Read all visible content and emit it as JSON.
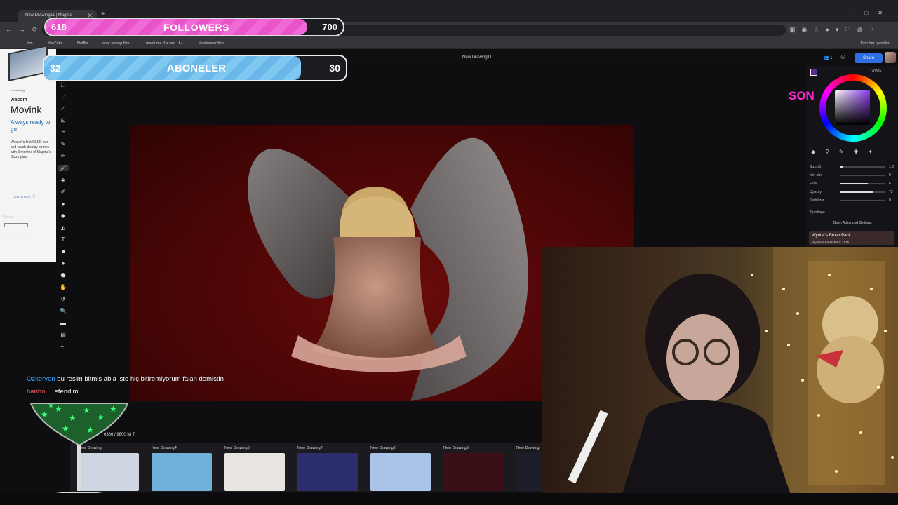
{
  "browser": {
    "tab_title": "New Drawing11 | Magma",
    "bookmarks": [
      "film",
      "YouTube",
      "Netflix",
      "onur savaşı film",
      "mach me if u can - f...",
      "Zoolander film",
      "Tüm Yer İşaretleri"
    ]
  },
  "app": {
    "doc_title": "New Drawing11",
    "user_count": "1",
    "share_label": "Share"
  },
  "overlay": {
    "followers": {
      "current": "618",
      "label": "FOLLOWERS",
      "goal": "700",
      "progress": 0.88
    },
    "subs": {
      "current": "32",
      "label": "ABONELER",
      "goal": "30",
      "progress": 0.85
    },
    "side_text": "SON"
  },
  "ad": {
    "intro": "Introducing",
    "brand": "wacom",
    "product": "Movink",
    "tagline": "Always ready to go",
    "desc": "Wacom's first OLED pen and touch display comes with 3 months of Magma's Blaze plan.",
    "learn_more": "Learn more",
    "privacy": "Privacy",
    "remove_ads": "Remove ads"
  },
  "color_panel": {
    "hex": "1c082e",
    "size_label": "Size x1",
    "size_val": "1.0",
    "sliders": [
      {
        "label": "Min size",
        "value": "0",
        "fill": 0.0
      },
      {
        "label": "Flow",
        "value": "61",
        "fill": 0.61
      },
      {
        "label": "Opacity",
        "value": "73",
        "fill": 0.73
      },
      {
        "label": "Stabilizer",
        "value": "0",
        "fill": 0.0
      }
    ],
    "tip_shape": "Tip shape",
    "advanced": "Open Advanced Settings",
    "brush_pack_title": "Wynter's Brush Pack",
    "brush_pack_sub": "Wynter's Brush Pack · 525"
  },
  "chat": [
    {
      "user": "Ozkerven",
      "message": "bu resim bitmiş abla işte hiç bitiremiyorum falan demiştin"
    },
    {
      "user": "haribo",
      "message": "... efendim"
    }
  ],
  "xp_text": "6386 / 9600 lvl 7",
  "gallery": [
    {
      "label": "New Drawing",
      "color": "#cfd6e2"
    },
    {
      "label": "New Drawing4",
      "color": "#6fb1d8"
    },
    {
      "label": "New Drawing6",
      "color": "#e8e4e2"
    },
    {
      "label": "New Drawing7",
      "color": "#2a2e6a"
    },
    {
      "label": "New Drawing2",
      "color": "#a9c4e6"
    },
    {
      "label": "New Drawing3",
      "color": "#3a0f16"
    },
    {
      "label": "New Drawing",
      "color": "#1e1e2a"
    }
  ]
}
